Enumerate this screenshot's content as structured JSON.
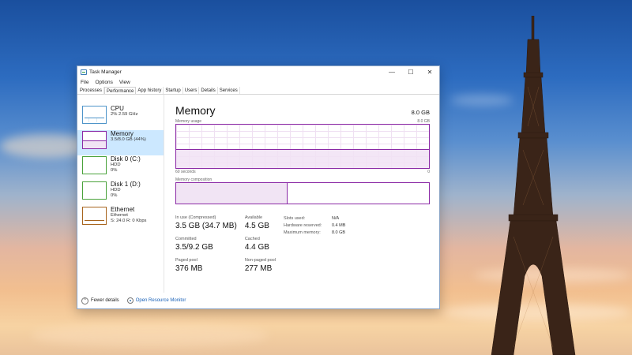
{
  "window": {
    "title": "Task Manager",
    "controls": {
      "minimize": "—",
      "maximize": "☐",
      "close": "✕"
    }
  },
  "menu": [
    "File",
    "Options",
    "View"
  ],
  "tabs": [
    {
      "label": "Processes",
      "active": false
    },
    {
      "label": "Performance",
      "active": true
    },
    {
      "label": "App history",
      "active": false
    },
    {
      "label": "Startup",
      "active": false
    },
    {
      "label": "Users",
      "active": false
    },
    {
      "label": "Details",
      "active": false
    },
    {
      "label": "Services",
      "active": false
    }
  ],
  "sidebar": {
    "items": [
      {
        "name": "CPU",
        "sub1": "2% 2.59 GHz",
        "sub2": "",
        "sub3": ""
      },
      {
        "name": "Memory",
        "sub1": "3.5/8.0 GB (44%)",
        "sub2": "",
        "sub3": ""
      },
      {
        "name": "Disk 0 (C:)",
        "sub1": "HDD",
        "sub2": "0%",
        "sub3": ""
      },
      {
        "name": "Disk 1 (D:)",
        "sub1": "HDD",
        "sub2": "0%",
        "sub3": ""
      },
      {
        "name": "Ethernet",
        "sub1": "Ethernet",
        "sub2": "S: 24.0 R: 0 Kbps",
        "sub3": ""
      }
    ]
  },
  "main": {
    "title": "Memory",
    "total": "8.0 GB",
    "usage_label": "Memory usage",
    "usage_max": "8.0 GB",
    "time_left": "60 seconds",
    "time_right": "0",
    "usage_fraction": 0.44,
    "composition_label": "Memory composition",
    "composition_in_use_fraction": 0.44,
    "stats": {
      "in_use_label": "In use (Compressed)",
      "in_use_value": "3.5 GB (34.7 MB)",
      "available_label": "Available",
      "available_value": "4.5 GB",
      "committed_label": "Committed",
      "committed_value": "3.5/9.2 GB",
      "cached_label": "Cached",
      "cached_value": "4.4 GB",
      "paged_label": "Paged pool",
      "paged_value": "376 MB",
      "nonpaged_label": "Non-paged pool",
      "nonpaged_value": "277 MB"
    },
    "details": [
      {
        "key": "Slots used:",
        "value": "N/A"
      },
      {
        "key": "Hardware reserved:",
        "value": "0.4 MB"
      },
      {
        "key": "Maximum memory:",
        "value": "8.0 GB"
      }
    ]
  },
  "footer": {
    "fewer_details": "Fewer details",
    "open_resource_monitor": "Open Resource Monitor"
  },
  "colors": {
    "memory_accent": "#8b2aa6",
    "selected_bg": "#cce8ff",
    "link": "#1a62b8"
  }
}
